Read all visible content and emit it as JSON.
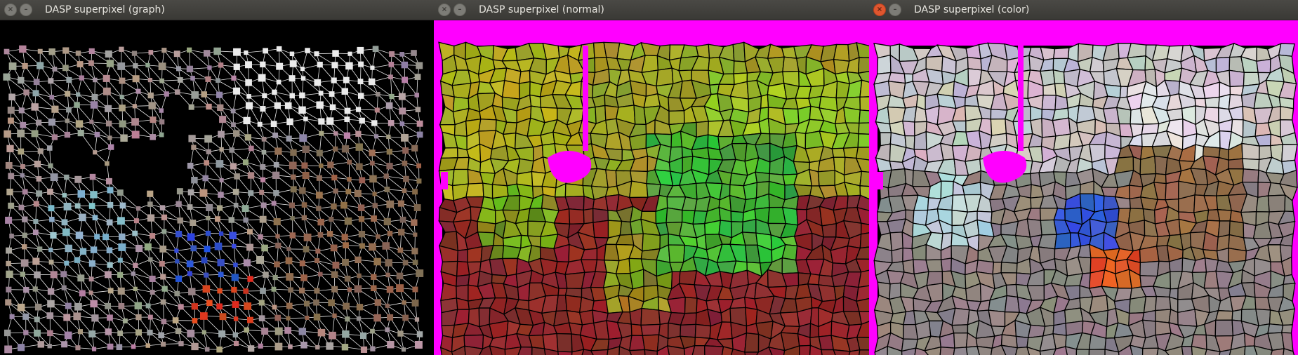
{
  "windows": [
    {
      "title": "DASP superpixel (graph)",
      "variant": "graph",
      "active": false
    },
    {
      "title": "DASP superpixel (normal)",
      "variant": "normal",
      "active": false
    },
    {
      "title": "DASP superpixel (color)",
      "variant": "color",
      "active": true
    }
  ],
  "colors": {
    "titlebar": "#3c3b37",
    "title_text": "#e8e6e0",
    "magenta_background": "#ff00ff",
    "graph_background": "#000000",
    "close_active": "#e0562f"
  },
  "icons": {
    "close": "close-icon",
    "minimize": "minimize-icon"
  }
}
